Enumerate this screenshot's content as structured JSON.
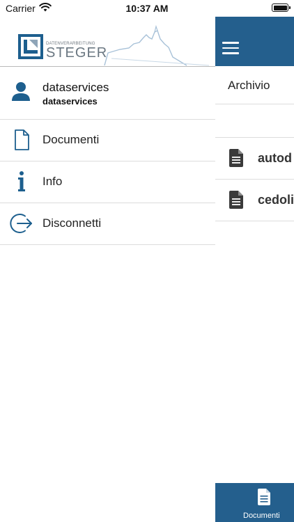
{
  "status": {
    "carrier": "Carrier",
    "time": "10:37 AM",
    "icons": [
      "wifi-icon",
      "battery-icon"
    ]
  },
  "drawer": {
    "logo": {
      "small_text": "DATENVERARBEITUNG",
      "name": "STEGER"
    },
    "user": {
      "name": "dataservices",
      "subtitle": "dataservices",
      "icon": "user-icon"
    },
    "items": [
      {
        "label": "Documenti",
        "icon": "document-icon"
      },
      {
        "label": "Info",
        "icon": "info-icon"
      },
      {
        "label": "Disconnetti",
        "icon": "logout-icon"
      }
    ]
  },
  "main": {
    "menu_icon": "hamburger-icon",
    "archive_label": "Archivio",
    "files": [
      {
        "name": "autod",
        "icon": "file-icon"
      },
      {
        "name": "cedoli",
        "icon": "file-icon"
      }
    ],
    "tab": {
      "label": "Documenti",
      "icon": "document-icon"
    }
  },
  "colors": {
    "brand_blue": "#245f8d",
    "icon_blue": "#1d5f8e",
    "divider": "#dcdcdc"
  }
}
